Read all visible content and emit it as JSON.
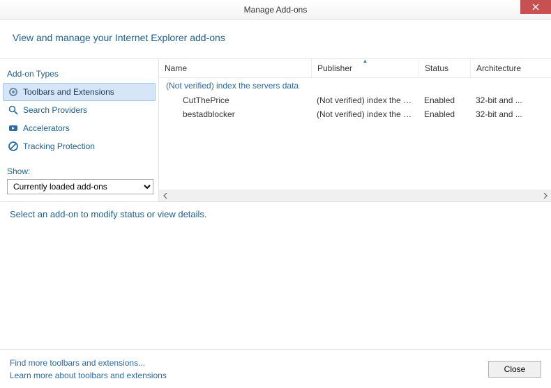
{
  "titlebar": {
    "title": "Manage Add-ons"
  },
  "header": {
    "text": "View and manage your Internet Explorer add-ons"
  },
  "sidebar": {
    "heading": "Add-on Types",
    "items": [
      {
        "label": "Toolbars and Extensions"
      },
      {
        "label": "Search Providers"
      },
      {
        "label": "Accelerators"
      },
      {
        "label": "Tracking Protection"
      }
    ],
    "show_label": "Show:",
    "show_value": "Currently loaded add-ons"
  },
  "list": {
    "columns": {
      "name": "Name",
      "publisher": "Publisher",
      "status": "Status",
      "architecture": "Architecture"
    },
    "group_label": "(Not verified) index the servers data",
    "rows": [
      {
        "name": "CutThePrice",
        "publisher": "(Not verified) index the s...",
        "status": "Enabled",
        "architecture": "32-bit and ..."
      },
      {
        "name": "bestadblocker",
        "publisher": "(Not verified) index the s...",
        "status": "Enabled",
        "architecture": "32-bit and ..."
      }
    ]
  },
  "details": {
    "prompt": "Select an add-on to modify status or view details."
  },
  "footer": {
    "link1": "Find more toolbars and extensions...",
    "link2": "Learn more about toolbars and extensions",
    "close": "Close"
  }
}
